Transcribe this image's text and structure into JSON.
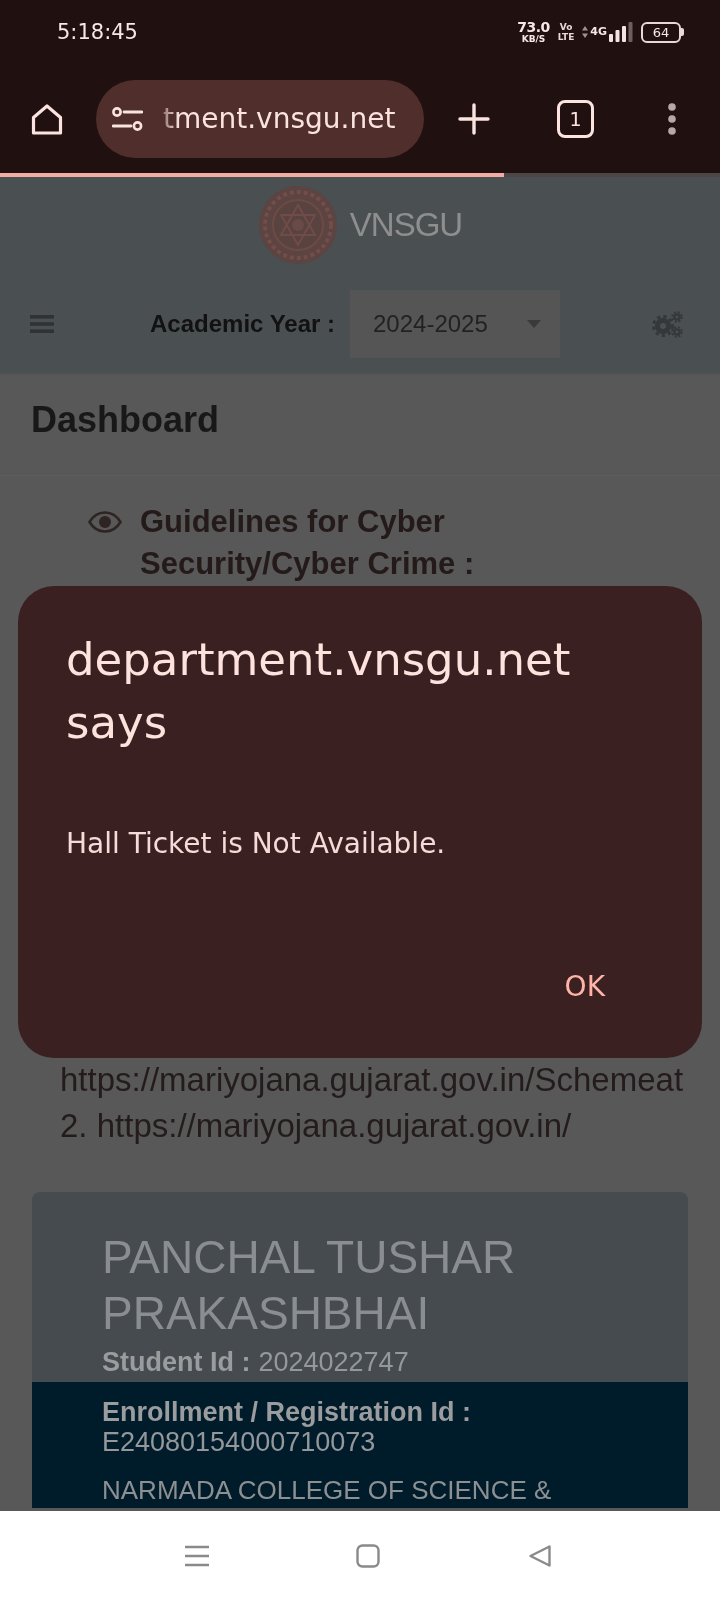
{
  "status_bar": {
    "time": "5:18:45",
    "net_speed": "73.0",
    "net_speed_unit": "KB/S",
    "volte_top": "Vo",
    "volte_bottom": "LTE",
    "network": "4G",
    "battery": "64"
  },
  "browser_toolbar": {
    "url": "tment.vnsgu.net",
    "tab_count": "1",
    "progress": {
      "level": 0.7
    }
  },
  "page": {
    "header": {
      "logo_text": "VNSGU",
      "academic_year_label": "Academic Year :",
      "academic_year_value": "2024-2025"
    },
    "title": "Dashboard",
    "guidelines_heading": "Guidelines for Cyber Security/Cyber Crime :",
    "links": [
      "https://mariyojana.gujarat.gov.in/Schemeat",
      "2. https://mariyojana.gujarat.gov.in/"
    ],
    "student_card": {
      "name": "PANCHAL TUSHAR PRAKASHBHAI",
      "fields": [
        {
          "label": "Student Id :",
          "value": "2024022747"
        },
        {
          "label": "Enrollment / Registration Id :",
          "value": "E24080154000710073"
        }
      ],
      "college": "NARMADA COLLEGE OF SCIENCE &"
    }
  },
  "dialog": {
    "title": "department.vnsgu.net says",
    "message": "Hall Ticket is Not Available.",
    "buttons": [
      "OK"
    ]
  }
}
